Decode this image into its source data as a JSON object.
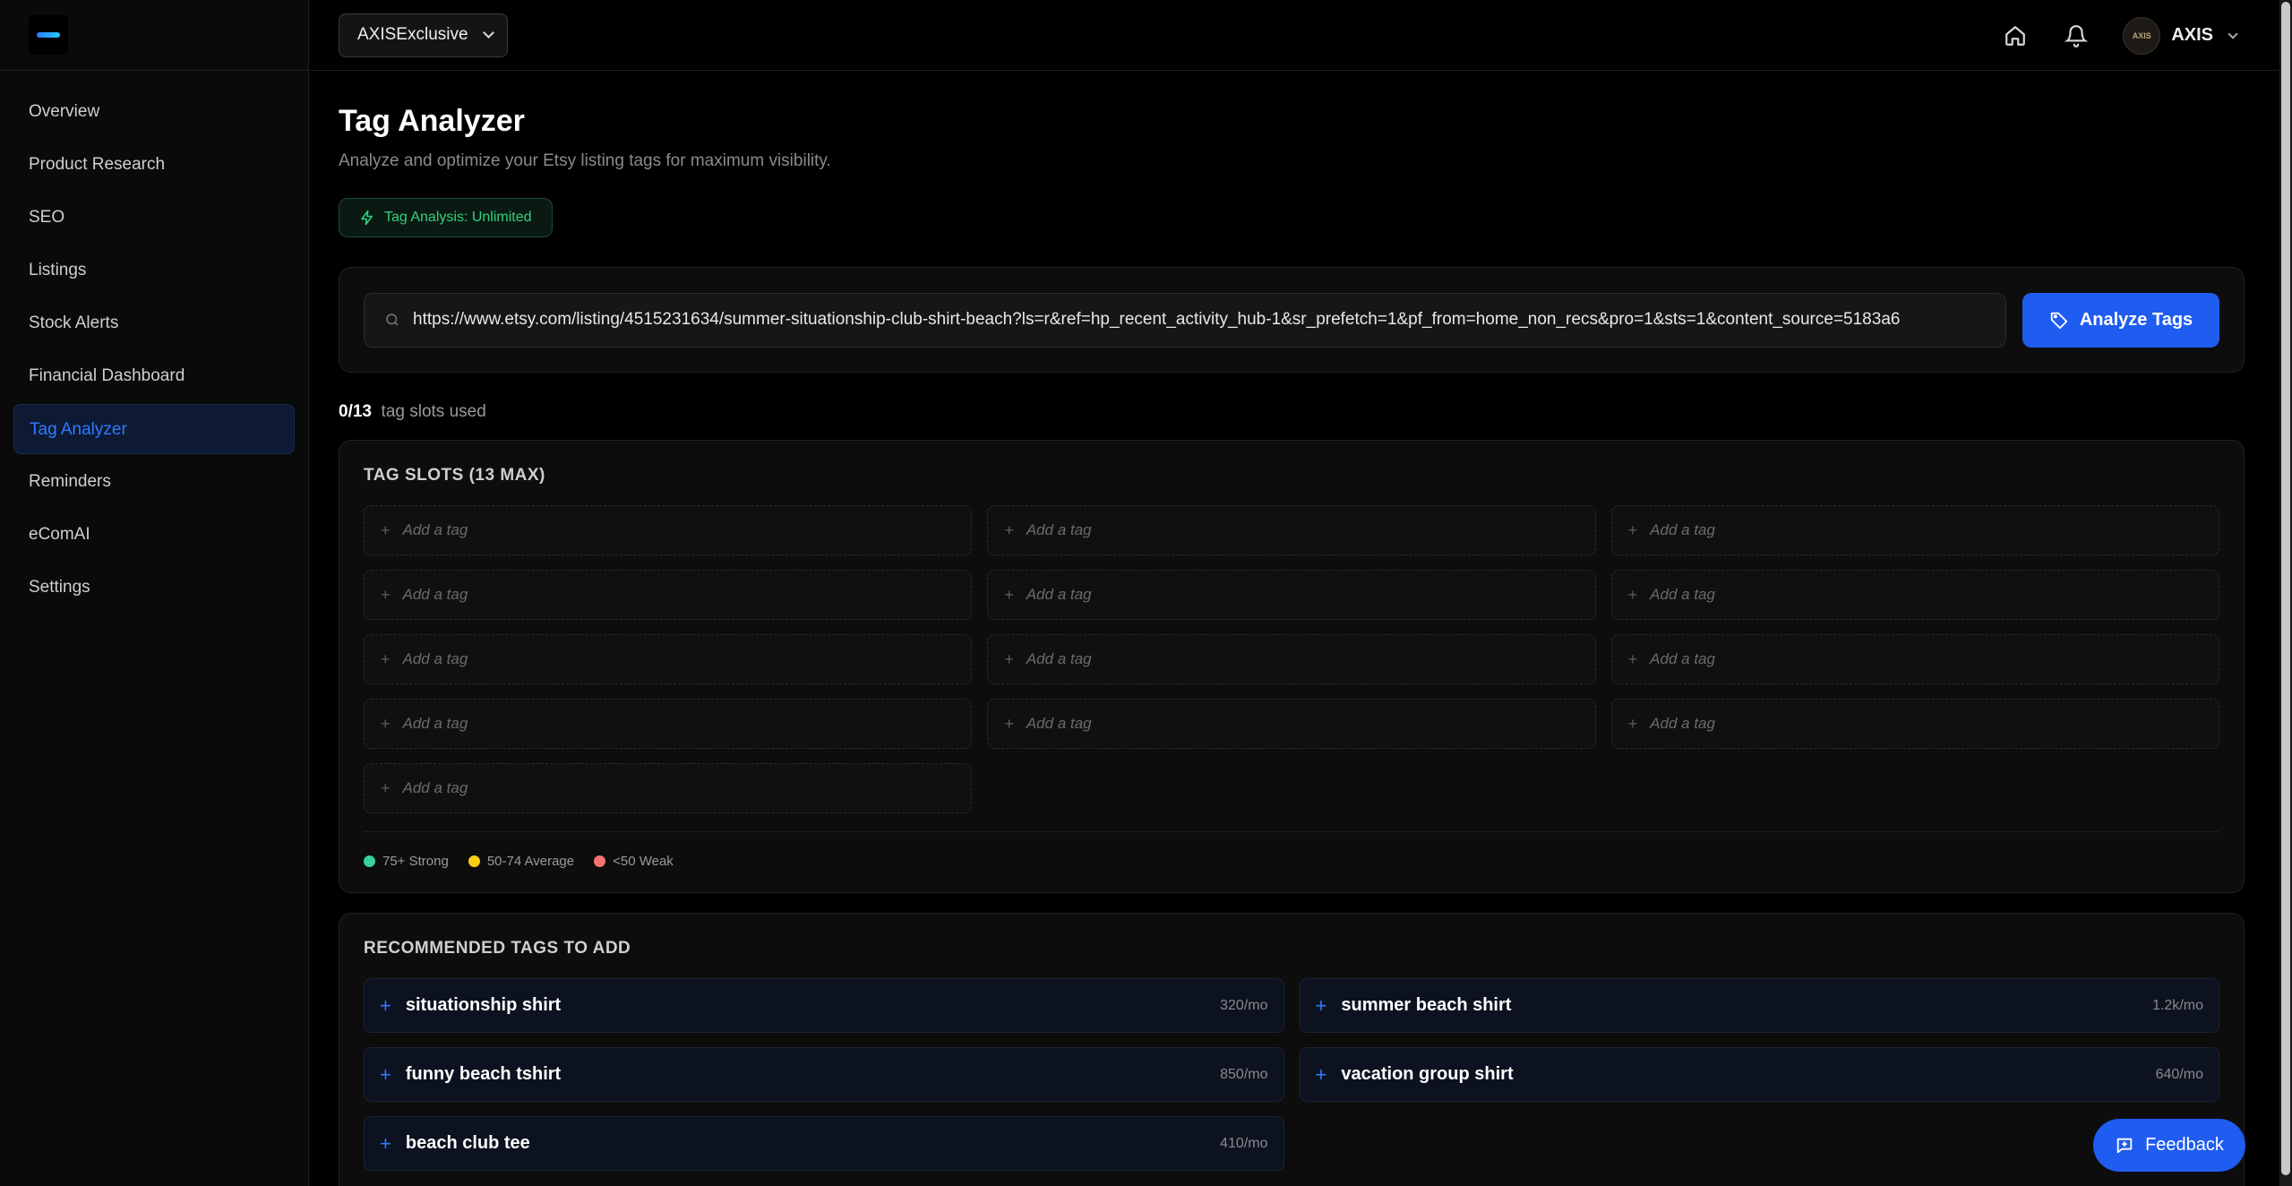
{
  "brand": {
    "logo_icon": "axis-logo-icon"
  },
  "sidebar": {
    "items": [
      {
        "label": "Overview",
        "active": false
      },
      {
        "label": "Product Research",
        "active": false
      },
      {
        "label": "SEO",
        "active": false
      },
      {
        "label": "Listings",
        "active": false
      },
      {
        "label": "Stock Alerts",
        "active": false
      },
      {
        "label": "Financial Dashboard",
        "active": false
      },
      {
        "label": "Tag Analyzer",
        "active": true
      },
      {
        "label": "Reminders",
        "active": false
      },
      {
        "label": "eComAI",
        "active": false
      },
      {
        "label": "Settings",
        "active": false
      }
    ]
  },
  "header": {
    "store_select": "AXISExclusive",
    "user_name": "AXIS",
    "avatar_text": "AXIS"
  },
  "page": {
    "title": "Tag Analyzer",
    "subtitle": "Analyze and optimize your Etsy listing tags for maximum visibility.",
    "badge": "Tag Analysis: Unlimited"
  },
  "search": {
    "value": "https://www.etsy.com/listing/4515231634/summer-situationship-club-shirt-beach?ls=r&ref=hp_recent_activity_hub-1&sr_prefetch=1&pf_from=home_non_recs&pro=1&sts=1&content_source=5183a6",
    "button": "Analyze Tags"
  },
  "slots": {
    "used": "0/13",
    "used_suffix": "tag slots used",
    "title": "TAG SLOTS (13 MAX)",
    "placeholder": "Add a tag",
    "count": 13
  },
  "legend": [
    {
      "label": "75+ Strong",
      "color": "#34d399"
    },
    {
      "label": "50-74 Average",
      "color": "#facc15"
    },
    {
      "label": "<50 Weak",
      "color": "#f87171"
    }
  ],
  "recommended": {
    "title": "RECOMMENDED TAGS TO ADD",
    "items": [
      {
        "label": "situationship shirt",
        "volume": "320/mo"
      },
      {
        "label": "summer beach shirt",
        "volume": "1.2k/mo"
      },
      {
        "label": "funny beach tshirt",
        "volume": "850/mo"
      },
      {
        "label": "vacation group shirt",
        "volume": "640/mo"
      },
      {
        "label": "beach club tee",
        "volume": "410/mo"
      }
    ]
  },
  "feedback": {
    "label": "Feedback"
  },
  "colors": {
    "accent": "#1f5cf0",
    "success": "#34d07f",
    "background": "#000000"
  }
}
